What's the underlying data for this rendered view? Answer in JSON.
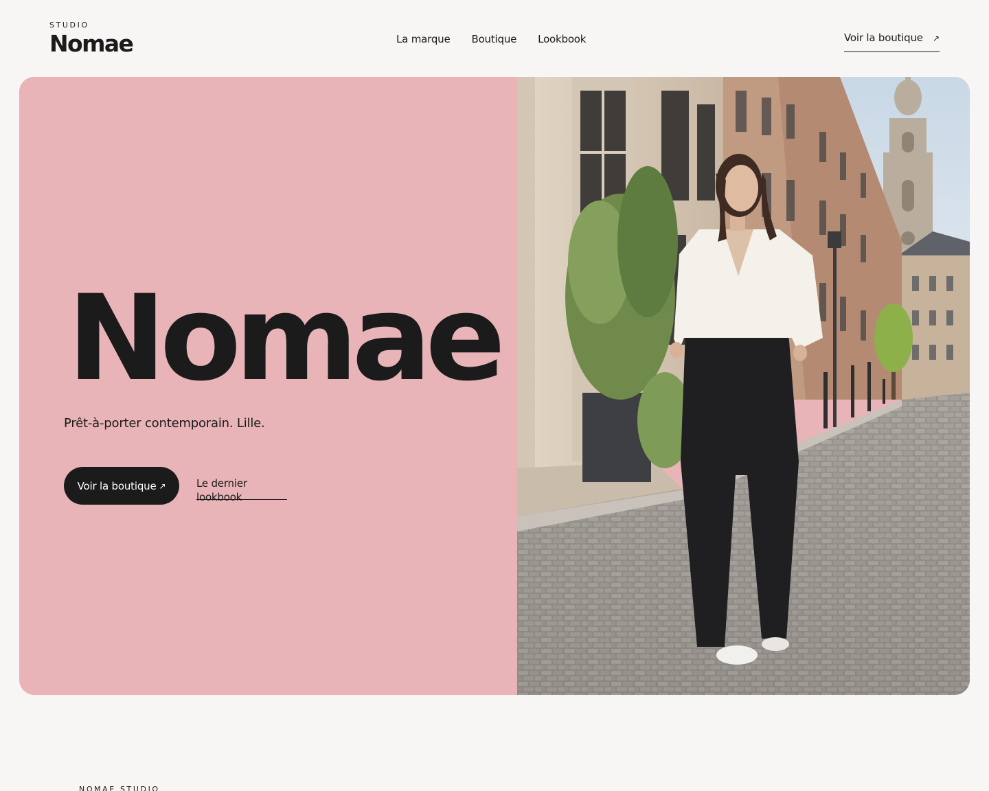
{
  "header": {
    "logo": {
      "eyebrow": "STUDIO",
      "name": "Nomae"
    },
    "nav": [
      {
        "label": "La marque"
      },
      {
        "label": "Boutique"
      },
      {
        "label": "Lookbook"
      }
    ],
    "cta": {
      "label": "Voir la boutique",
      "icon": "arrow-up-right-icon",
      "arrow": "↗"
    }
  },
  "hero": {
    "title": "Nomae",
    "subtitle": "Prêt-à-porter contemporain. Lille.",
    "primary_button": {
      "label": "Voir la boutique",
      "arrow": "↗"
    },
    "secondary_link": {
      "label": "Le dernier lookbook"
    },
    "background_color": "#e8b4b7",
    "image": "photo of a woman in a white shirt and black wide trousers walking on a cobblestone street with a belfry tower"
  },
  "footer": {
    "eyebrow": "NOMAE STUDIO"
  },
  "colors": {
    "page": "#f8f6f4",
    "text": "#1c1b1b",
    "accent_pink": "#e8b4b7"
  }
}
